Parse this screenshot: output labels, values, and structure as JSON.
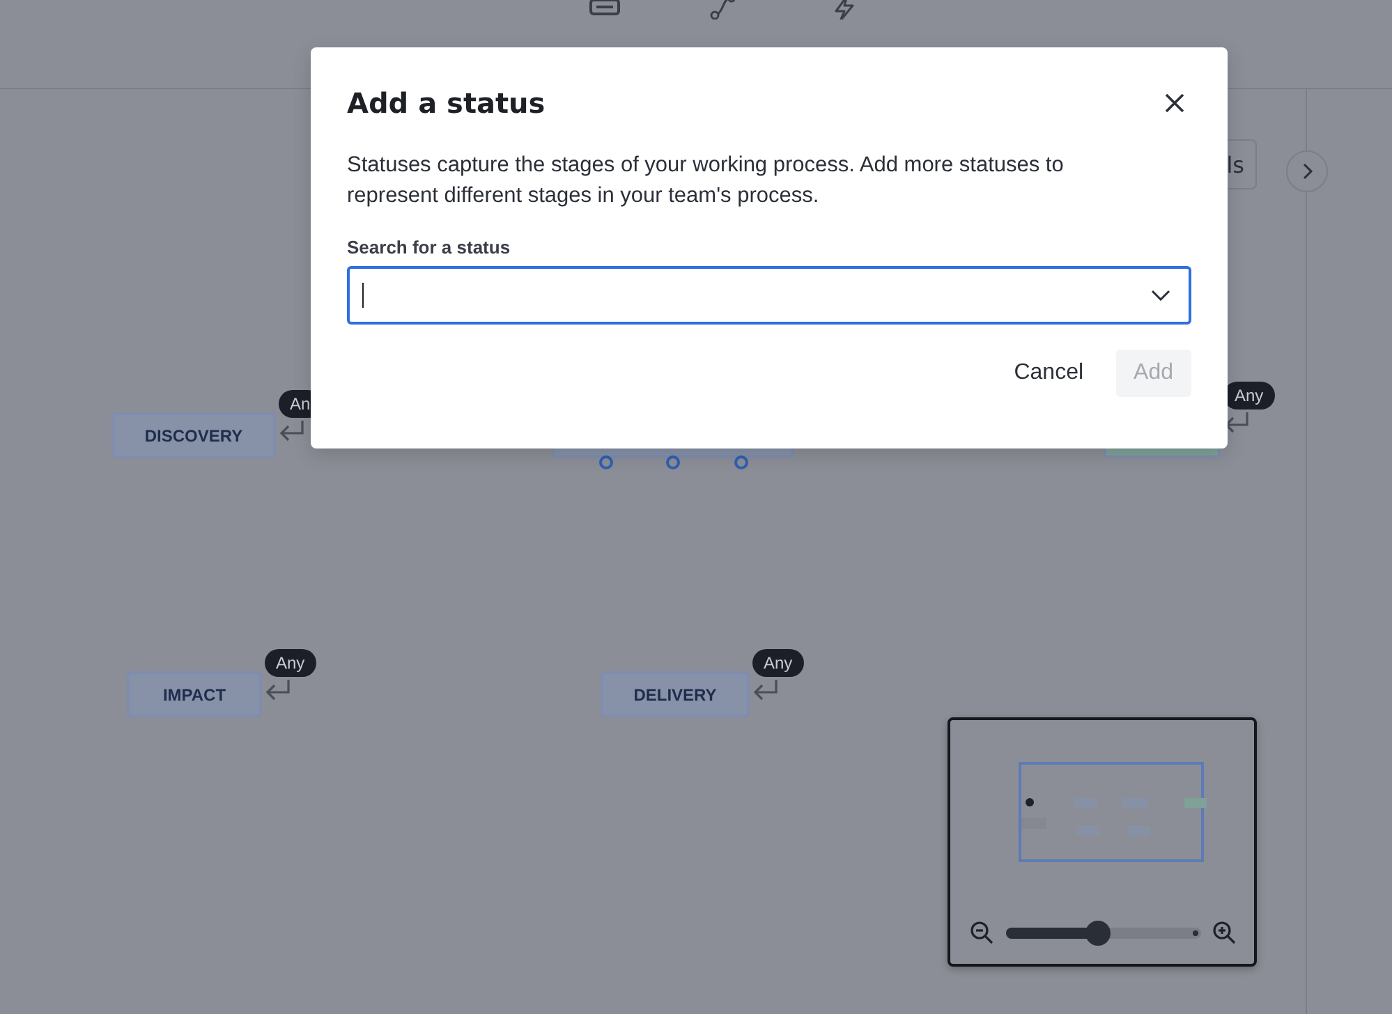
{
  "toolbar": {
    "items": [
      {
        "kind": "status"
      },
      {
        "kind": "transition"
      },
      {
        "kind": "rule"
      }
    ]
  },
  "side_button": {
    "label": "ls"
  },
  "canvas": {
    "nodes": [
      {
        "kind": "status",
        "label": "DISCOVERY",
        "badge": "An",
        "color": "#8792a8"
      },
      {
        "kind": "covered",
        "color": "#8792a8"
      },
      {
        "kind": "covered",
        "badge": "Any",
        "color": "#7fa197"
      },
      {
        "kind": "status",
        "label": "IMPACT",
        "badge": "Any",
        "color": "#8792a8"
      },
      {
        "kind": "status",
        "label": "DELIVERY",
        "badge": "Any",
        "color": "#8792a8"
      }
    ]
  },
  "minimap": {
    "zoom": {
      "level": 0.47
    }
  },
  "dialog": {
    "title": "Add a status",
    "description": "Statuses capture the stages of your working process. Add more statuses to represent different stages in your team's process.",
    "field_label": "Search for a status",
    "field": {
      "focused": true
    },
    "buttons": [
      {
        "label": "Cancel",
        "kind": "text",
        "disabled": false
      },
      {
        "label": "Add",
        "kind": "primary",
        "disabled": true
      }
    ]
  }
}
